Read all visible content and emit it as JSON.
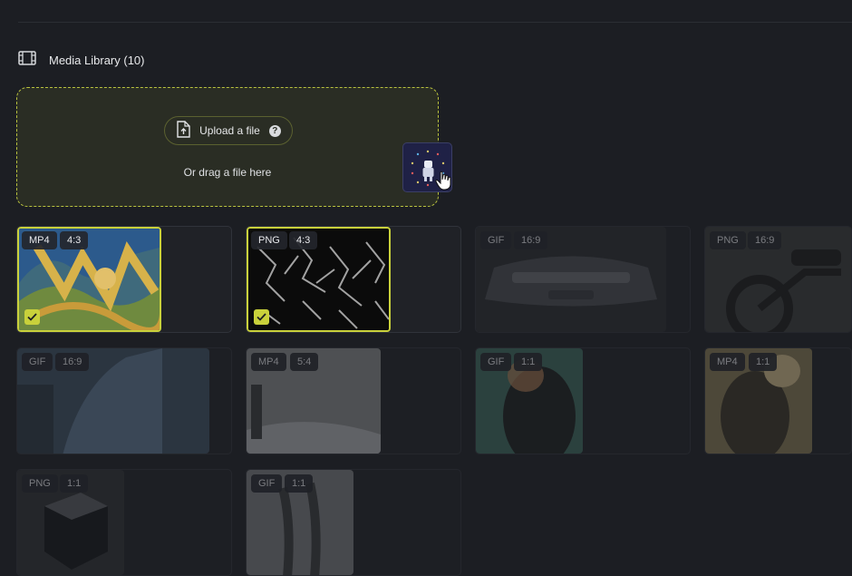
{
  "library": {
    "title": "Media Library (10)"
  },
  "upload": {
    "button_label": "Upload a file",
    "help": "?",
    "drag_text": "Or drag a file here"
  },
  "media": [
    {
      "format": "MP4",
      "ratio": "4:3",
      "selected": true
    },
    {
      "format": "PNG",
      "ratio": "4:3",
      "selected": true
    },
    {
      "format": "GIF",
      "ratio": "16:9",
      "selected": false
    },
    {
      "format": "PNG",
      "ratio": "16:9",
      "selected": false
    },
    {
      "format": "GIF",
      "ratio": "16:9",
      "selected": false
    },
    {
      "format": "MP4",
      "ratio": "5:4",
      "selected": false
    },
    {
      "format": "GIF",
      "ratio": "1:1",
      "selected": false
    },
    {
      "format": "MP4",
      "ratio": "1:1",
      "selected": false
    },
    {
      "format": "PNG",
      "ratio": "1:1",
      "selected": false
    },
    {
      "format": "GIF",
      "ratio": "1:1",
      "selected": false
    }
  ],
  "colors": {
    "accent": "#c9d13b",
    "background": "#1c1e23",
    "dropzone": "#2a2d24"
  }
}
